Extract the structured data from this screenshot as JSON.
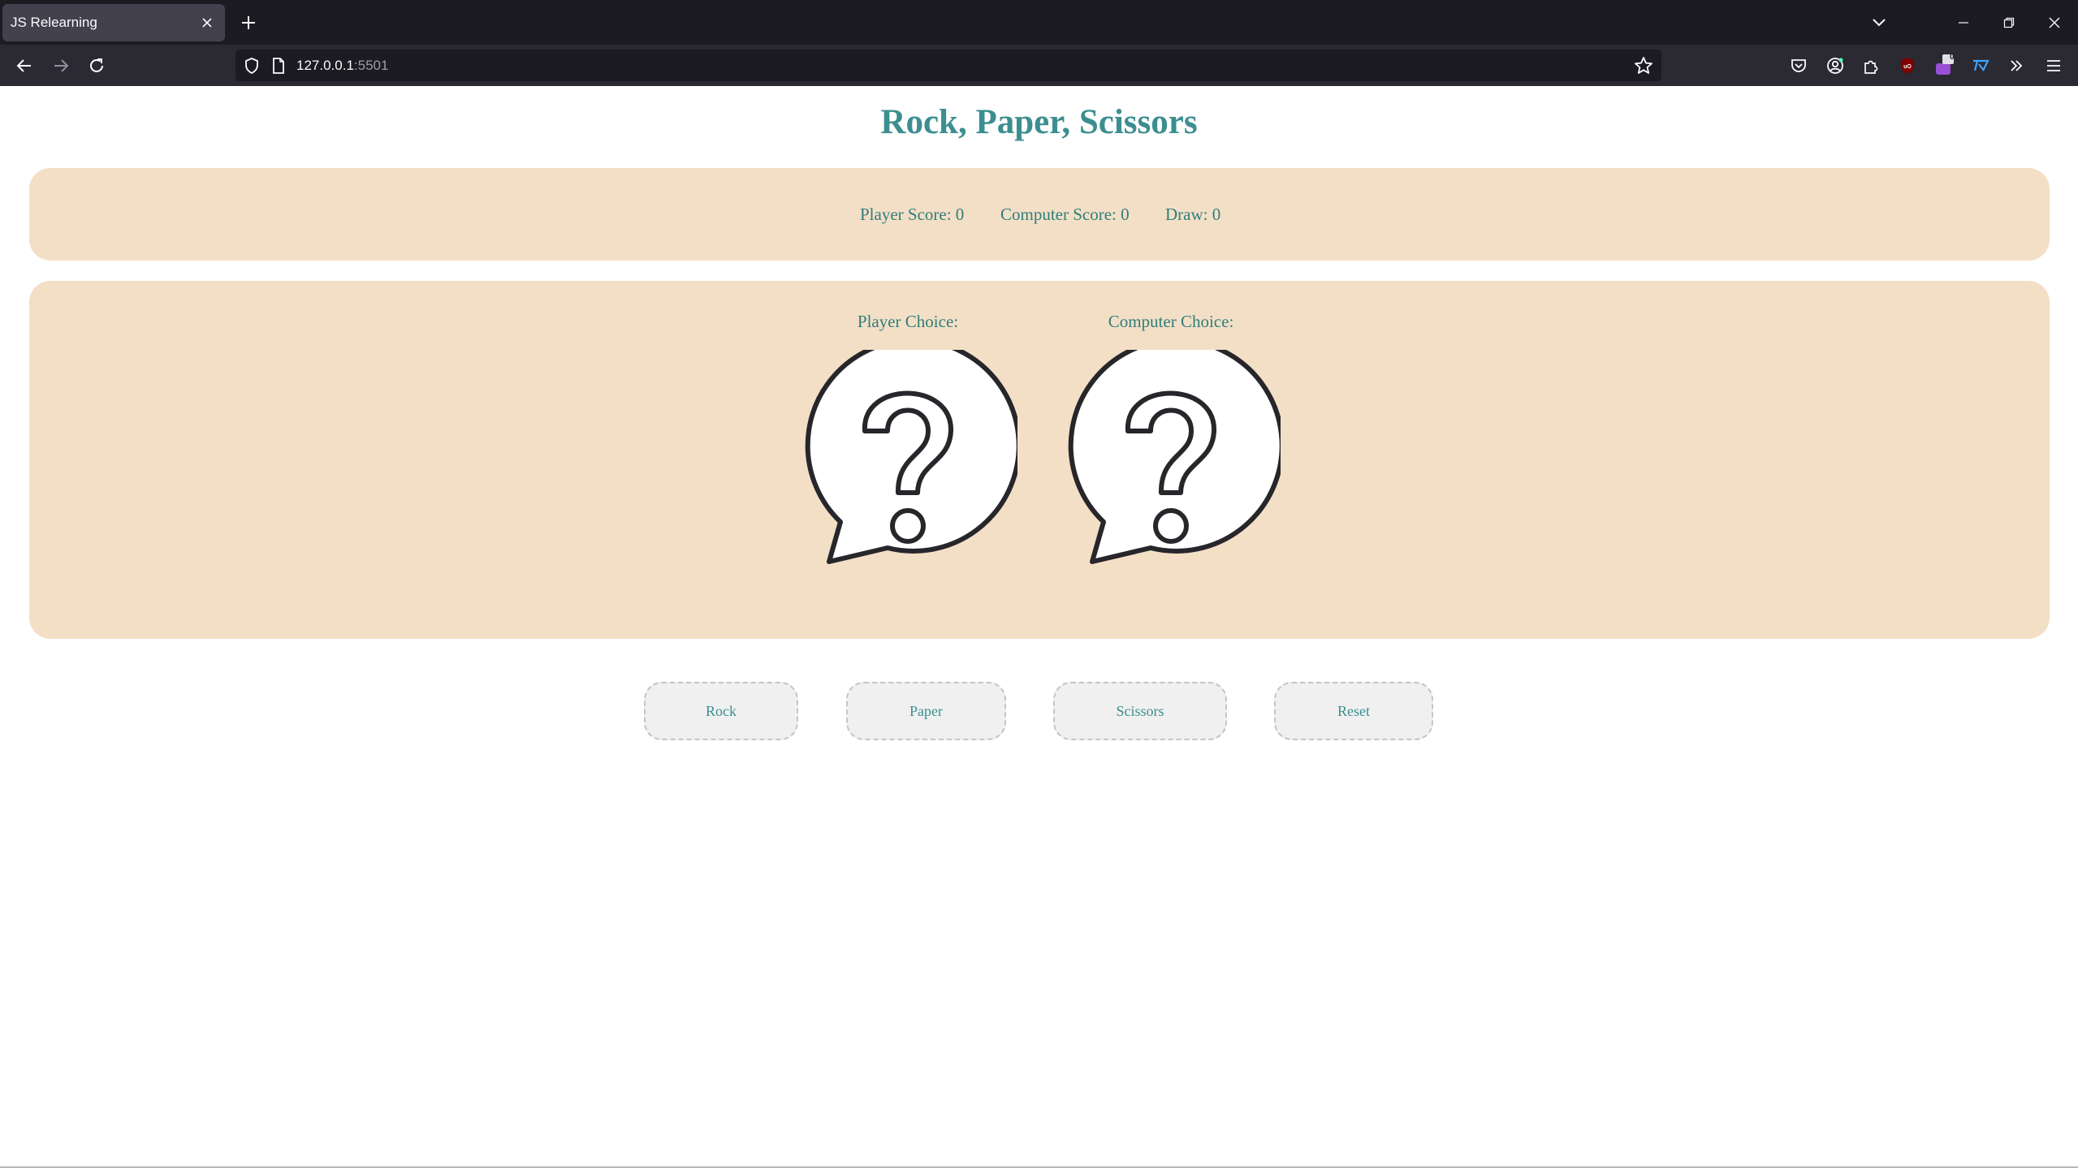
{
  "browser": {
    "tab_title": "JS Relearning",
    "url_host": "127.0.0.1",
    "url_port": ":5501",
    "extension_badge": "0"
  },
  "game": {
    "title": "Rock, Paper, Scissors",
    "scores": {
      "player_label": "Player Score: 0",
      "computer_label": "Computer Score: 0",
      "draw_label": "Draw: 0"
    },
    "choices": {
      "player_label": "Player Choice:",
      "computer_label": "Computer Choice:",
      "player_icon": "question-bubble-icon",
      "computer_icon": "question-bubble-icon"
    },
    "buttons": {
      "rock": "Rock",
      "paper": "Paper",
      "scissors": "Scissors",
      "reset": "Reset"
    }
  },
  "colors": {
    "title": "#3c8e90",
    "panel_bg": "#f3dfc6",
    "text": "#2f7e7a",
    "button_bg": "#f0f0f0"
  }
}
